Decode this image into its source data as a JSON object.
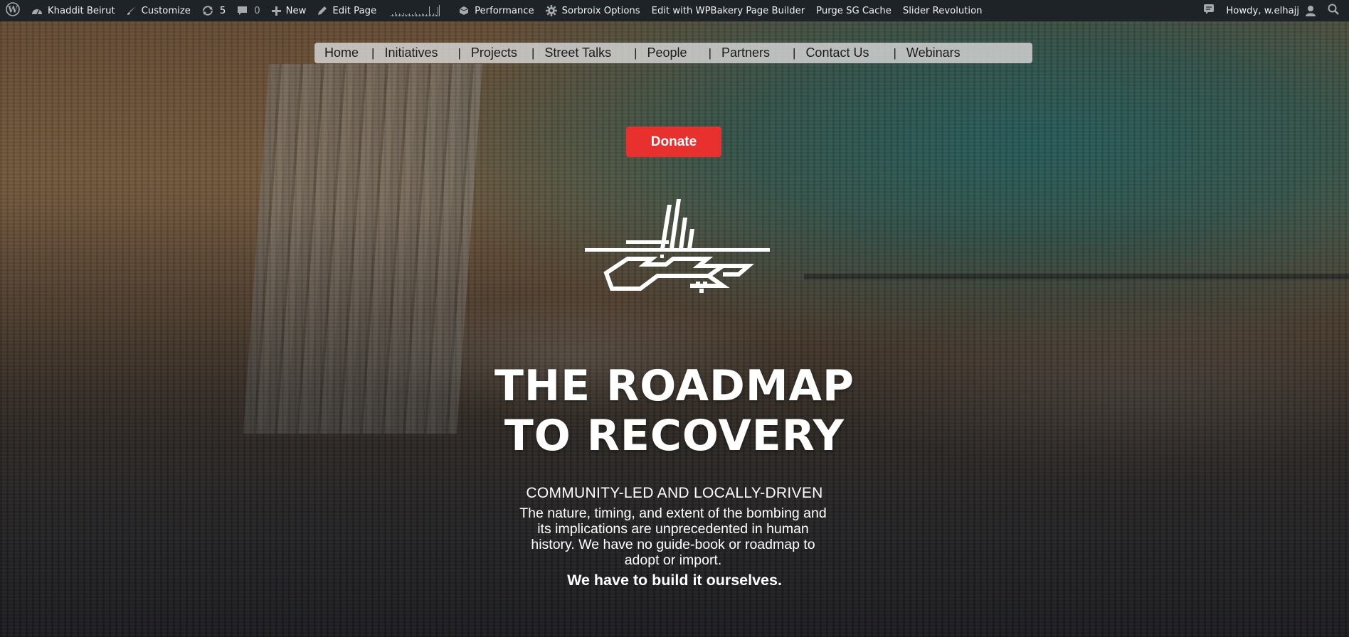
{
  "adminbar": {
    "site_name": "Khaddit Beirut",
    "customize": "Customize",
    "updates_count": "5",
    "comments_count": "0",
    "new_label": "New",
    "edit_page": "Edit Page",
    "performance": "Performance",
    "sorbroix": "Sorbroix Options",
    "wpbakery": "Edit with WPBakery Page Builder",
    "purge_cache": "Purge SG Cache",
    "slider_revolution": "Slider Revolution",
    "howdy": "Howdy, w.elhajj",
    "icons": {
      "wp_logo": "wordpress-icon",
      "site": "dashboard-icon",
      "customize": "brush-icon",
      "updates": "updates-icon",
      "comments": "comment-icon",
      "new": "plus-icon",
      "edit": "pencil-icon",
      "performance": "database-icon",
      "sorbroix": "gear-icon",
      "notifications": "comment-icon",
      "account": "user-icon",
      "search": "search-icon"
    }
  },
  "nav": {
    "items": [
      {
        "label": "Home"
      },
      {
        "label": "Initiatives"
      },
      {
        "label": "Projects"
      },
      {
        "label": "Street Talks"
      },
      {
        "label": "People"
      },
      {
        "label": "Partners"
      },
      {
        "label": "Contact Us"
      },
      {
        "label": "Webinars"
      }
    ],
    "separator": "|"
  },
  "donate_label": "Donate",
  "hero": {
    "headline_line1": "THE ROADMAP",
    "headline_line2": "TO RECOVERY",
    "subhead": "COMMUNITY-LED AND LOCALLY-DRIVEN",
    "body_line1": "The nature, timing, and extent of the bombing and",
    "body_line2": "its implications are unprecedented in human",
    "body_line3": "history. We have no guide-book or roadmap to",
    "body_line4": "adopt or import.",
    "tagline": "We have to build it ourselves."
  },
  "colors": {
    "adminbar_bg": "#1d2327",
    "donate_bg": "#e8302f",
    "nav_bg": "rgba(215,215,215,0.82)"
  }
}
